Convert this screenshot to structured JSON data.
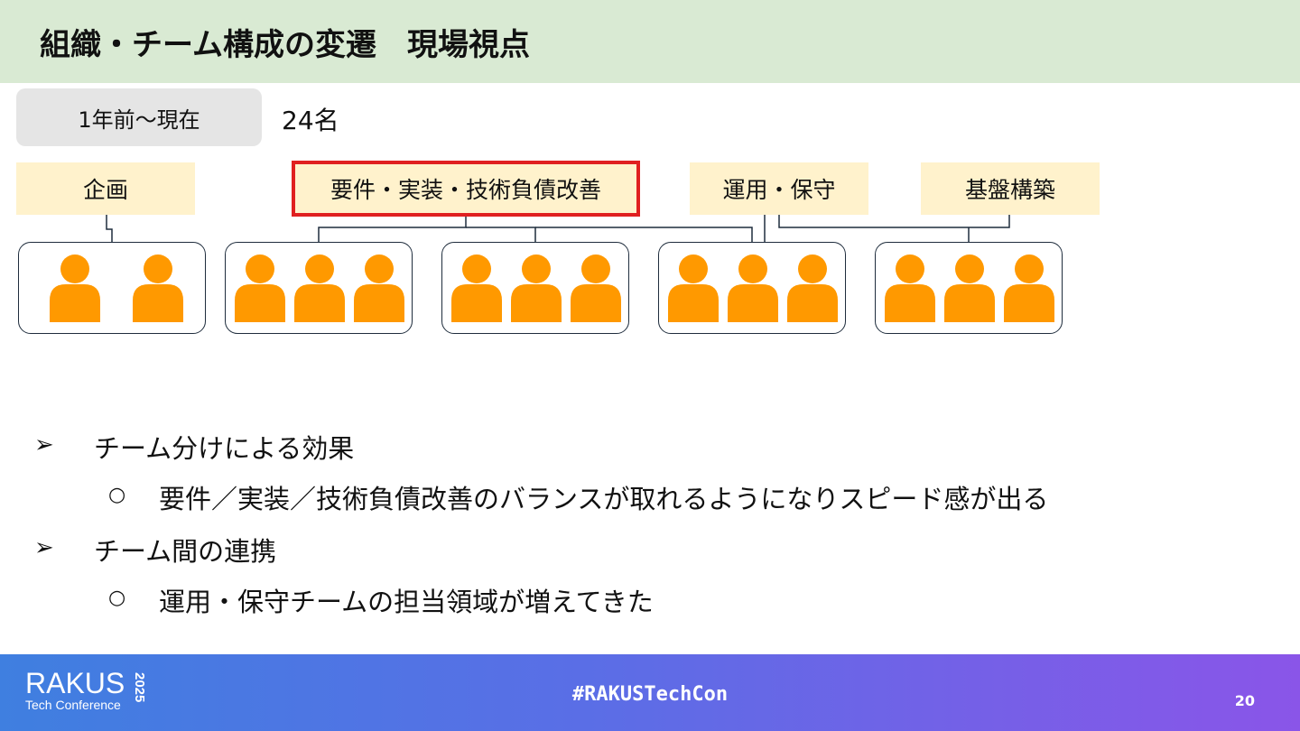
{
  "header": {
    "title": "組織・チーム構成の変遷　現場視点"
  },
  "period": {
    "label": "1年前〜現在",
    "count": "24名"
  },
  "teams": [
    {
      "label": "企画",
      "members": 2
    },
    {
      "label": "要件・実装・技術負債改善",
      "members": 6,
      "highlighted": true
    },
    {
      "label": "運用・保守",
      "members": 3
    },
    {
      "label": "基盤構築",
      "members": 3
    }
  ],
  "bullets": [
    {
      "text": "チーム分けによる効果",
      "sub": "要件／実装／技術負債改善のバランスが取れるようになりスピード感が出る"
    },
    {
      "text": "チーム間の連携",
      "sub": "運用・保守チームの担当領域が増えてきた"
    }
  ],
  "markers": {
    "bullet": "➢",
    "sub": "○"
  },
  "footer": {
    "logo_main": "RAKUS",
    "logo_sub": "Tech Conference",
    "logo_year": "2025",
    "hashtag": "#RAKUSTechCon",
    "page_number": "20"
  },
  "colors": {
    "header_bg": "#d9ead3",
    "label_bg": "#fff2cc",
    "highlight_border": "#e02020",
    "person": "#ff9900"
  }
}
